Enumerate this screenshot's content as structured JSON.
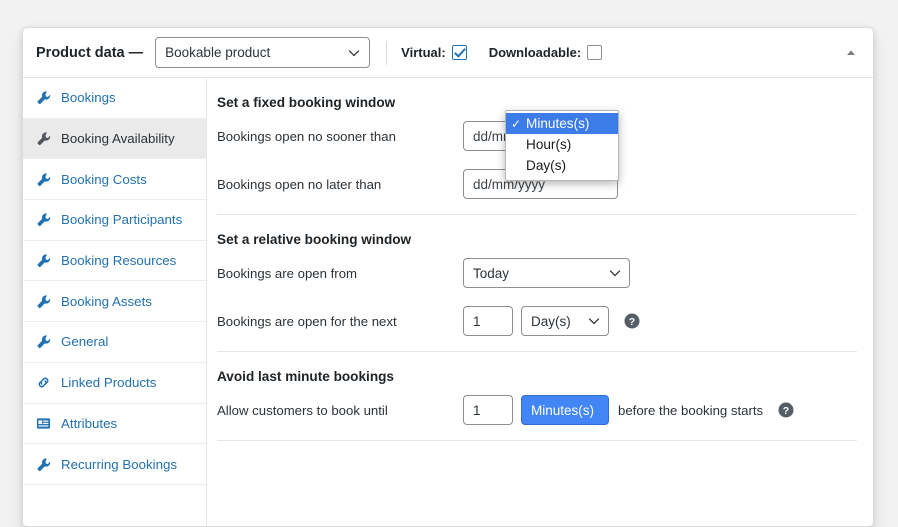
{
  "header": {
    "title": "Product data —",
    "product_type": "Bookable product",
    "virtual_label": "Virtual:",
    "virtual_checked": true,
    "downloadable_label": "Downloadable:",
    "downloadable_checked": false,
    "collapse_icon": "caret-up-icon"
  },
  "sidebar": {
    "items": [
      {
        "label": "Bookings",
        "icon": "wrench-icon",
        "active": false
      },
      {
        "label": "Booking Availability",
        "icon": "wrench-icon",
        "active": true
      },
      {
        "label": "Booking Costs",
        "icon": "wrench-icon",
        "active": false
      },
      {
        "label": "Booking Participants",
        "icon": "wrench-icon",
        "active": false
      },
      {
        "label": "Booking Resources",
        "icon": "wrench-icon",
        "active": false
      },
      {
        "label": "Booking Assets",
        "icon": "wrench-icon",
        "active": false
      },
      {
        "label": "General",
        "icon": "wrench-icon",
        "active": false
      },
      {
        "label": "Linked Products",
        "icon": "link-icon",
        "active": false
      },
      {
        "label": "Attributes",
        "icon": "attributes-icon",
        "active": false
      },
      {
        "label": "Recurring Bookings",
        "icon": "wrench-icon",
        "active": false
      }
    ]
  },
  "sections": {
    "fixed_window": {
      "title": "Set a fixed booking window",
      "sooner_label": "Bookings open no sooner than",
      "sooner_placeholder": "dd/mm/yyyy",
      "sooner_value": "",
      "later_label": "Bookings open no later than",
      "later_placeholder": "dd/mm/yyyy",
      "later_value": ""
    },
    "relative_window": {
      "title": "Set a relative booking window",
      "from_label": "Bookings are open from",
      "from_value": "Today",
      "next_label": "Bookings are open for the next",
      "next_value": "1",
      "next_unit": "Day(s)",
      "help_icon": "help-icon"
    },
    "last_minute": {
      "title": "Avoid last minute bookings",
      "until_label": "Allow customers to book until",
      "until_value": "1",
      "until_unit": "Minutes(s)",
      "trailing_text": "before the booking starts",
      "help_icon": "help-icon"
    }
  },
  "dropdown": {
    "open": true,
    "selected": "Minutes(s)",
    "options": [
      "Minutes(s)",
      "Hour(s)",
      "Day(s)"
    ]
  },
  "colors": {
    "link": "#2271b1",
    "accent": "#3b7ce8",
    "active_bg": "#eaeaea"
  }
}
